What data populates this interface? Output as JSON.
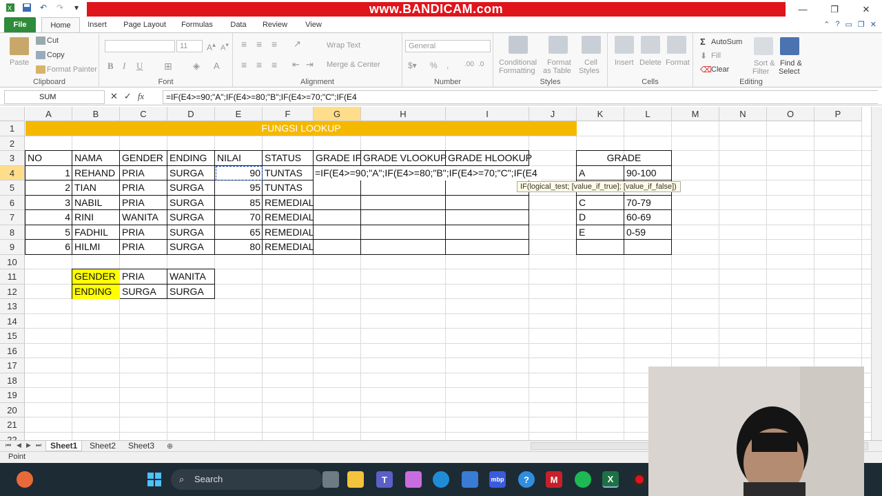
{
  "titlebar": {
    "watermark": "www.BANDICAM.com",
    "window_controls": {
      "minimize": "—",
      "maximize": "❐",
      "close": "✕"
    }
  },
  "ribbon_tabs": [
    "File",
    "Home",
    "Insert",
    "Page Layout",
    "Formulas",
    "Data",
    "Review",
    "View"
  ],
  "ribbon": {
    "clipboard": {
      "paste": "Paste",
      "cut": "Cut",
      "copy": "Copy",
      "format_painter": "Format Painter",
      "label": "Clipboard"
    },
    "font": {
      "font_name": "",
      "font_size": "11",
      "bold": "B",
      "italic": "I",
      "underline": "U",
      "label": "Font"
    },
    "alignment": {
      "wrap": "Wrap Text",
      "merge": "Merge & Center",
      "label": "Alignment"
    },
    "number": {
      "format": "General",
      "label": "Number"
    },
    "styles": {
      "conditional": "Conditional",
      "conditional2": "Formatting",
      "table": "Format",
      "table2": "as Table",
      "cell": "Cell",
      "cell2": "Styles",
      "label": "Styles"
    },
    "cells": {
      "insert": "Insert",
      "delete": "Delete",
      "format": "Format",
      "label": "Cells"
    },
    "editing": {
      "autosum": "AutoSum",
      "fill": "Fill",
      "clear": "Clear",
      "sort": "Sort &",
      "sort2": "Filter",
      "find": "Find &",
      "find2": "Select",
      "label": "Editing"
    }
  },
  "formula_bar": {
    "name_box": "SUM",
    "formula": "=IF(E4>=90;\"A\";IF(E4>=80;\"B\";IF(E4>=70;\"C\";IF(E4"
  },
  "columns": [
    "A",
    "B",
    "C",
    "D",
    "E",
    "F",
    "G",
    "H",
    "I",
    "J",
    "K",
    "L",
    "M",
    "N",
    "O",
    "P"
  ],
  "rows": [
    "1",
    "2",
    "3",
    "4",
    "5",
    "6",
    "7",
    "8",
    "9",
    "10",
    "11",
    "12",
    "13",
    "14",
    "15",
    "16",
    "17",
    "18",
    "19",
    "20",
    "21",
    "22"
  ],
  "sheet": {
    "title": "FUNGSI LOOKUP",
    "headers": [
      "NO",
      "NAMA",
      "GENDER",
      "ENDING",
      "NILAI",
      "STATUS",
      "GRADE IF",
      "GRADE VLOOKUP",
      "GRADE HLOOKUP"
    ],
    "data_rows": [
      {
        "no": "1",
        "nama": "REHAND",
        "gender": "PRIA",
        "ending": "SURGA",
        "nilai": "90",
        "status": "TUNTAS"
      },
      {
        "no": "2",
        "nama": "TIAN",
        "gender": "PRIA",
        "ending": "SURGA",
        "nilai": "95",
        "status": "TUNTAS"
      },
      {
        "no": "3",
        "nama": "NABIL",
        "gender": "PRIA",
        "ending": "SURGA",
        "nilai": "85",
        "status": "REMEDIAL"
      },
      {
        "no": "4",
        "nama": "RINI",
        "gender": "WANITA",
        "ending": "SURGA",
        "nilai": "70",
        "status": "REMEDIAL"
      },
      {
        "no": "5",
        "nama": "FADHIL",
        "gender": "PRIA",
        "ending": "SURGA",
        "nilai": "65",
        "status": "REMEDIAL"
      },
      {
        "no": "6",
        "nama": "HILMI",
        "gender": "PRIA",
        "ending": "SURGA",
        "nilai": "80",
        "status": "REMEDIAL"
      }
    ],
    "editing_formula": "=IF(E4>=90;\"A\";IF(E4>=80;\"B\";IF(E4>=70;\"C\";IF(E4",
    "tooltip": "IF(logical_test; [value_if_true]; [value_if_false])",
    "grade_table": {
      "header": "GRADE",
      "rows": [
        {
          "grade": "A",
          "range": "90-100"
        },
        {
          "grade": "C",
          "range": "70-79"
        },
        {
          "grade": "D",
          "range": "60-69"
        },
        {
          "grade": "E",
          "range": "0-59"
        }
      ]
    },
    "hlookup_table": {
      "rows": [
        {
          "label": "GENDER",
          "a": "PRIA",
          "b": "WANITA"
        },
        {
          "label": "ENDING",
          "a": "SURGA",
          "b": "SURGA"
        }
      ]
    }
  },
  "sheet_tabs": [
    "Sheet1",
    "Sheet2",
    "Sheet3"
  ],
  "status": "Point",
  "taskbar": {
    "search": "Search"
  },
  "colors": {
    "title_fill": "#f5b800",
    "label_fill": "#ffff00",
    "file_tab": "#2e8b3a",
    "watermark_bg": "#e0141b"
  }
}
